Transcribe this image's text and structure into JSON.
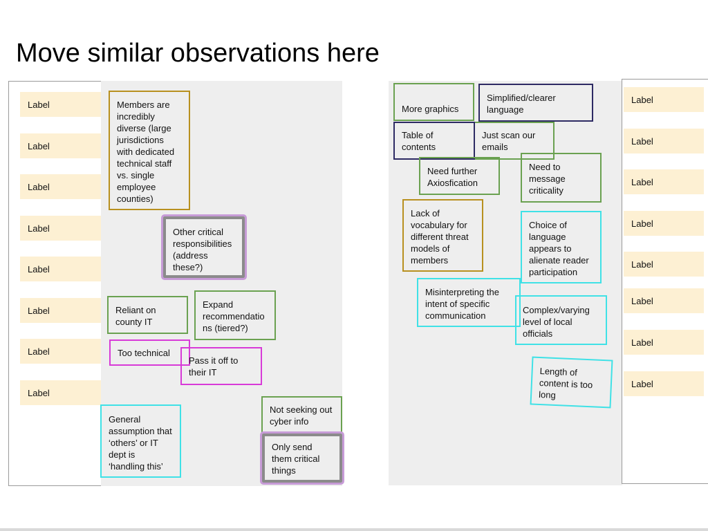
{
  "page": {
    "title": "Move similar observations here"
  },
  "left_labels": [
    "Label",
    "Label",
    "Label",
    "Label",
    "Label",
    "Label",
    "Label",
    "Label"
  ],
  "right_labels": [
    "Label",
    "Label",
    "Label",
    "Label",
    "Label",
    "Label",
    "Label",
    "Label"
  ],
  "colors": {
    "label_fill": "#fdf0d3",
    "board_fill": "#eeeeee",
    "gold": "#b8901f",
    "green": "#6aa150",
    "magenta": "#d83ad8",
    "cyan": "#3fe1e6",
    "navy": "#2d2a63",
    "purple_highlight": "#c79bd7"
  },
  "left_board": {
    "notes": [
      {
        "id": "members-diverse",
        "color": "gold",
        "text": "Members are incredibly diverse (large jurisdictions with dedicated technical staff vs. single employee counties)"
      },
      {
        "id": "other-critical",
        "color": "purple",
        "text": "Other critical responsibilities (address these?)"
      },
      {
        "id": "reliant-county-it",
        "color": "green",
        "text": "Reliant on county IT"
      },
      {
        "id": "expand-recommendations",
        "color": "green",
        "text": "Expand recommendatio ns (tiered?)"
      },
      {
        "id": "too-technical",
        "color": "magenta",
        "text": "Too technical"
      },
      {
        "id": "pass-it-off",
        "color": "magenta",
        "text": "Pass it off to their IT"
      },
      {
        "id": "general-assumption",
        "color": "cyan",
        "text": "General assumption that ‘others’ or IT dept is ‘handling this’"
      },
      {
        "id": "not-seeking",
        "color": "green",
        "text": "Not seeking out cyber info"
      },
      {
        "id": "only-send-critical",
        "color": "purple",
        "text": "Only send them critical things"
      }
    ]
  },
  "right_board": {
    "notes": [
      {
        "id": "more-graphics",
        "color": "green",
        "text": "More graphics"
      },
      {
        "id": "simplified-language",
        "color": "navy",
        "text": "Simplified/clearer language"
      },
      {
        "id": "table-of-contents",
        "color": "navy",
        "text": "Table of contents"
      },
      {
        "id": "just-scan",
        "color": "green",
        "text": "Just scan our emails"
      },
      {
        "id": "need-axiosfication",
        "color": "green",
        "text": "Need further Axiosfication"
      },
      {
        "id": "message-criticality",
        "color": "green",
        "text": "Need to message criticality"
      },
      {
        "id": "lack-vocabulary",
        "color": "gold",
        "text": "Lack of vocabulary for different threat models of members"
      },
      {
        "id": "choice-of-language",
        "color": "cyan",
        "text": "Choice of language appears to alienate reader participation"
      },
      {
        "id": "misinterpreting",
        "color": "cyan",
        "text": "Misinterpreting the intent of specific communication"
      },
      {
        "id": "complex-varying",
        "color": "cyan",
        "text": "Complex/varying level of local officials"
      },
      {
        "id": "length-too-long",
        "color": "cyan",
        "text": "Length of content is too long"
      }
    ]
  }
}
